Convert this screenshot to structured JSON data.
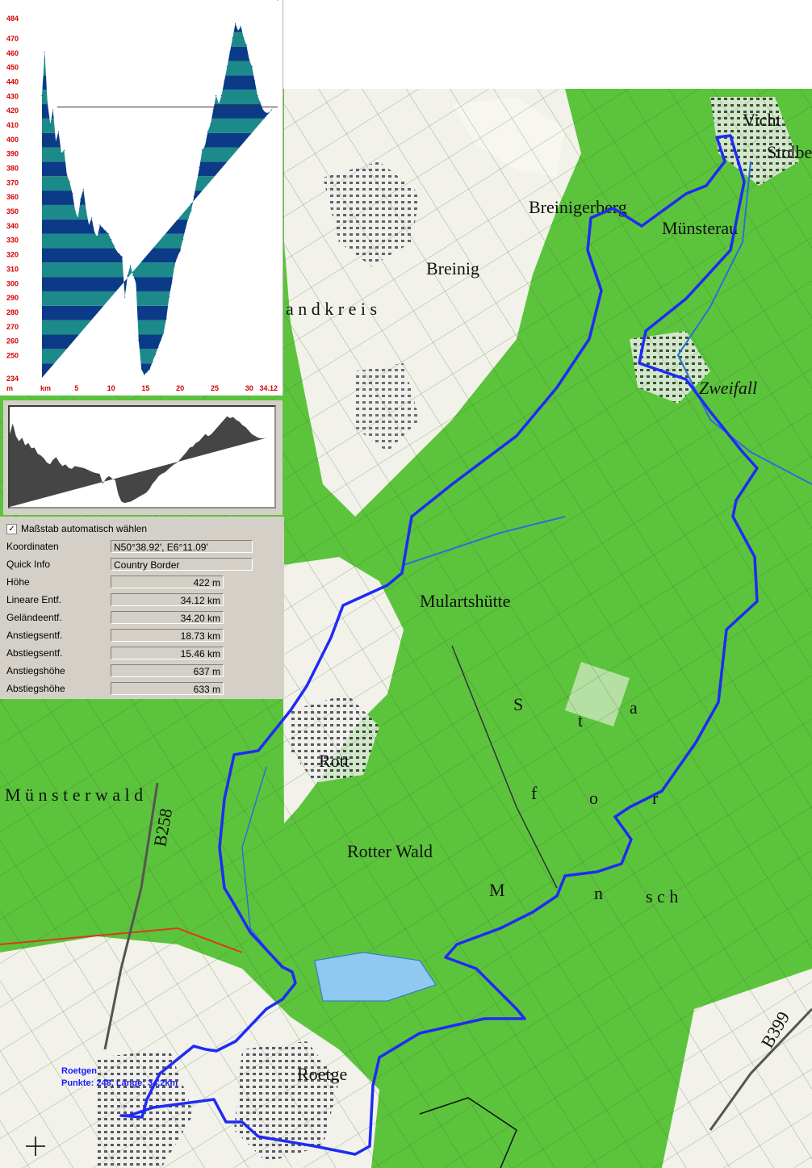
{
  "map": {
    "route_color": "#1f2bf5",
    "forest_color": "#5cc43c",
    "open_color": "#f2f2ea",
    "labels": {
      "zweifall": "Zweifall",
      "vicht": "Vicht",
      "stolberg": "Stolbe",
      "roetgen": "Roetge",
      "rott": "Rott",
      "breinig": "Breinig",
      "mulartshutte": "Mulartshütte",
      "breinigerberg": "Breinigerberg",
      "munsterau": "Münsterau",
      "rotter_wald": "Rotter Wald",
      "road_b258": "B258",
      "road_b399": "B399",
      "forest_s": "S",
      "forest_t": "t",
      "forest_a": "a",
      "forest_f": "f",
      "forest_o": "o",
      "forest_r": "r",
      "forest_m": "M",
      "forest_n": "n",
      "forest_sch": "s c h",
      "munsterwald": "M ü n s t e r w a l d",
      "stadtkreis": "a n d k r e i s"
    },
    "route_label_line1": "Roetgen",
    "route_label_line2": "Punkte: 248, Länge: 34,2km"
  },
  "elevation_profile": {
    "y_ticks": [
      "484",
      "470",
      "460",
      "450",
      "440",
      "430",
      "420",
      "410",
      "400",
      "390",
      "380",
      "370",
      "360",
      "350",
      "340",
      "330",
      "320",
      "310",
      "300",
      "290",
      "280",
      "270",
      "260",
      "250",
      "234"
    ],
    "y_unit": "m",
    "x_unit": "km",
    "x_ticks": [
      "5",
      "10",
      "15",
      "20",
      "25",
      "30",
      "34.12"
    ],
    "marker_elevation": 422,
    "colors": {
      "dark": "#0b3b86",
      "light": "#1d8a8a",
      "axis_label": "#d80000"
    }
  },
  "chart_data": {
    "type": "area",
    "title": "",
    "xlabel": "km",
    "ylabel": "m",
    "xlim": [
      0,
      34.12
    ],
    "ylim": [
      234,
      484
    ],
    "x": [
      0,
      0.4,
      0.8,
      1.2,
      1.6,
      2,
      2.4,
      2.8,
      3.2,
      3.6,
      4,
      4.4,
      4.8,
      5.2,
      5.6,
      6,
      6.4,
      6.8,
      7.2,
      7.6,
      8,
      8.4,
      8.8,
      9.2,
      9.6,
      10,
      10.4,
      10.8,
      11.2,
      11.6,
      12,
      12.4,
      12.8,
      13.2,
      13.6,
      14,
      14.4,
      14.8,
      15.2,
      15.6,
      16,
      16.4,
      16.8,
      17.2,
      17.6,
      18,
      18.4,
      18.8,
      19.2,
      19.6,
      20,
      20.4,
      20.8,
      21.2,
      21.6,
      22,
      22.4,
      22.8,
      23.2,
      23.6,
      24,
      24.4,
      24.8,
      25.2,
      25.6,
      26,
      26.4,
      26.8,
      27.2,
      27.6,
      28,
      28.4,
      28.8,
      29.2,
      29.6,
      30,
      30.4,
      30.8,
      31.2,
      31.6,
      32,
      32.4,
      32.8,
      33.2,
      33.6,
      34.12
    ],
    "series": [
      {
        "values": [
          430,
          460,
          425,
          410,
          420,
          398,
          405,
          390,
          392,
          375,
          370,
          362,
          350,
          345,
          358,
          365,
          350,
          340,
          345,
          335,
          332,
          340,
          338,
          336,
          334,
          330,
          326,
          322,
          320,
          318,
          290,
          305,
          312,
          305,
          300,
          260,
          240,
          236,
          238,
          240,
          245,
          250,
          255,
          260,
          265,
          275,
          290,
          300,
          312,
          318,
          322,
          330,
          338,
          345,
          350,
          360,
          370,
          380,
          392,
          395,
          405,
          410,
          420,
          430,
          424,
          430,
          440,
          450,
          460,
          470,
          480,
          475,
          478,
          470,
          465,
          455,
          450,
          440,
          430,
          425,
          420,
          418,
          418,
          420,
          422
        ]
      }
    ]
  },
  "info_panel": {
    "checkbox_label": "Maßstab automatisch wählen",
    "checkbox_mark": "✓",
    "rows": [
      {
        "label": "Koordinaten",
        "value": "N50°38.92', E6°11.09'"
      },
      {
        "label": "Quick Info",
        "value": "Country Border"
      },
      {
        "label": "Höhe",
        "value": "422 m"
      },
      {
        "label": "Lineare Entf.",
        "value": "34.12 km"
      },
      {
        "label": "Geländeentf.",
        "value": "34.20 km"
      },
      {
        "label": "Anstiegsentf.",
        "value": "18.73 km"
      },
      {
        "label": "Abstiegsentf.",
        "value": "15.46 km"
      },
      {
        "label": "Anstiegshöhe",
        "value": "637 m"
      },
      {
        "label": "Abstiegshöhe",
        "value": "633 m"
      }
    ]
  }
}
